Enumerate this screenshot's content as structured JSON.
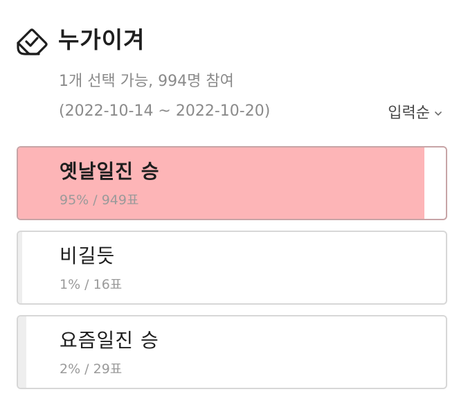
{
  "poll": {
    "title": "누가이겨",
    "info": "1개 선택 가능, 994명 참여",
    "period": "(2022-10-14 ~ 2022-10-20)",
    "sort_label": "입력순",
    "options": [
      {
        "label": "옛날일진 승",
        "stats": "95% / 949표",
        "percent": 95,
        "winner": true
      },
      {
        "label": "비길듯",
        "stats": "1% / 16표",
        "percent": 1,
        "winner": false
      },
      {
        "label": "요즘일진 승",
        "stats": "2% / 29표",
        "percent": 2,
        "winner": false
      }
    ]
  },
  "icons": {
    "header": "vote-check-icon",
    "sort": "chevron-down-icon"
  },
  "colors": {
    "winner_fill": "#fdb5b7",
    "other_fill": "#eeeeee",
    "title": "#1e1e1e",
    "muted": "#8a8a8a"
  }
}
